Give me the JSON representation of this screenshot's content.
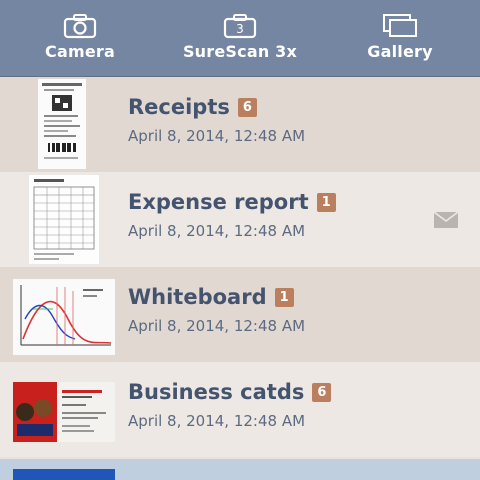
{
  "toolbar": {
    "camera_label": "Camera",
    "surescan_label": "SureScan 3x",
    "surescan_count": "3",
    "gallery_label": "Gallery"
  },
  "items": [
    {
      "title": "Receipts",
      "count": "6",
      "date": "April 8, 2014, 12:48 AM",
      "thumb_icon": "receipt-thumbnail"
    },
    {
      "title": "Expense report",
      "count": "1",
      "date": "April 8, 2014, 12:48 AM",
      "thumb_icon": "expense-report-thumbnail",
      "action_icon": "mail-icon"
    },
    {
      "title": "Whiteboard",
      "count": "1",
      "date": "April 8, 2014, 12:48 AM",
      "thumb_icon": "whiteboard-thumbnail"
    },
    {
      "title": "Business catds",
      "count": "6",
      "date": "April 8, 2014, 12:48 AM",
      "thumb_icon": "business-card-thumbnail"
    }
  ],
  "colors": {
    "toolbar": "#7486a2",
    "title": "#44546f",
    "badge": "#b97f5f",
    "date": "#5d6b82"
  }
}
